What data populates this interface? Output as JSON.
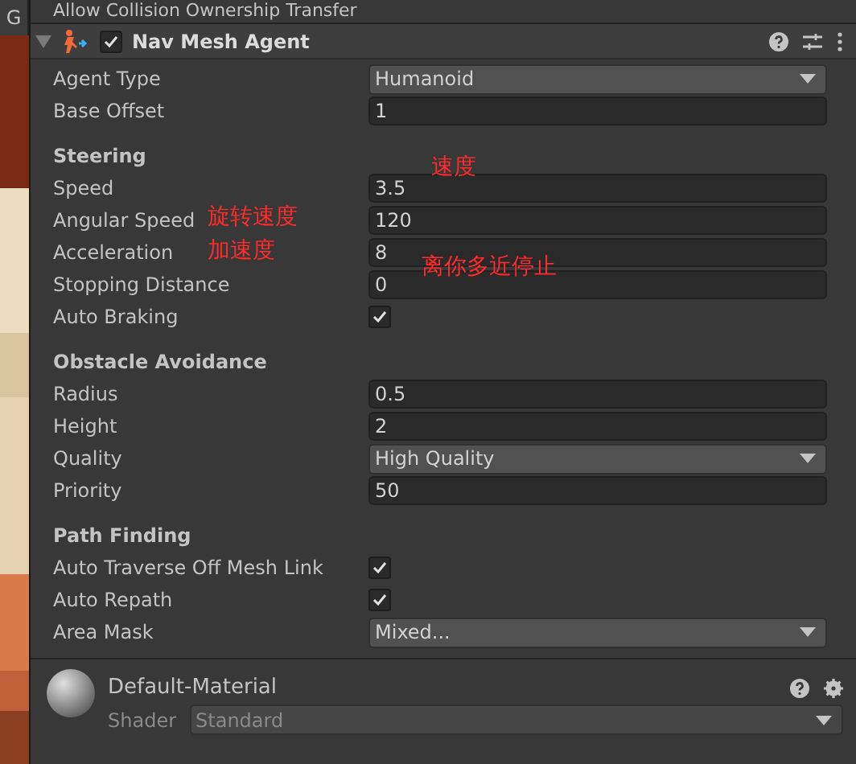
{
  "side_tab": {
    "label": "G"
  },
  "top_row": {
    "label": "Allow Collision Ownership Transfer"
  },
  "component": {
    "title": "Nav Mesh Agent",
    "enabled": true,
    "expanded": true,
    "rows": [
      {
        "kind": "dropdown",
        "label": "Agent Type",
        "value": "Humanoid"
      },
      {
        "kind": "field",
        "label": "Base Offset",
        "value": "1"
      },
      {
        "kind": "header",
        "label": "Steering"
      },
      {
        "kind": "field",
        "label": "Speed",
        "value": "3.5"
      },
      {
        "kind": "field",
        "label": "Angular Speed",
        "value": "120"
      },
      {
        "kind": "field",
        "label": "Acceleration",
        "value": "8"
      },
      {
        "kind": "field",
        "label": "Stopping Distance",
        "value": "0"
      },
      {
        "kind": "checkbox",
        "label": "Auto Braking",
        "checked": true
      },
      {
        "kind": "header",
        "label": "Obstacle Avoidance"
      },
      {
        "kind": "field",
        "label": "Radius",
        "value": "0.5"
      },
      {
        "kind": "field",
        "label": "Height",
        "value": "2"
      },
      {
        "kind": "dropdown",
        "label": "Quality",
        "value": "High Quality"
      },
      {
        "kind": "field",
        "label": "Priority",
        "value": "50"
      },
      {
        "kind": "header",
        "label": "Path Finding"
      },
      {
        "kind": "checkbox",
        "label": "Auto Traverse Off Mesh Link",
        "checked": true
      },
      {
        "kind": "checkbox",
        "label": "Auto Repath",
        "checked": true
      },
      {
        "kind": "dropdown",
        "label": "Area Mask",
        "value": "Mixed..."
      }
    ]
  },
  "annotations": [
    {
      "text": "速度"
    },
    {
      "text": "旋转速度"
    },
    {
      "text": "加速度"
    },
    {
      "text": "离你多近停止"
    }
  ],
  "material": {
    "name": "Default-Material",
    "shader_label": "Shader",
    "shader": "Standard"
  }
}
